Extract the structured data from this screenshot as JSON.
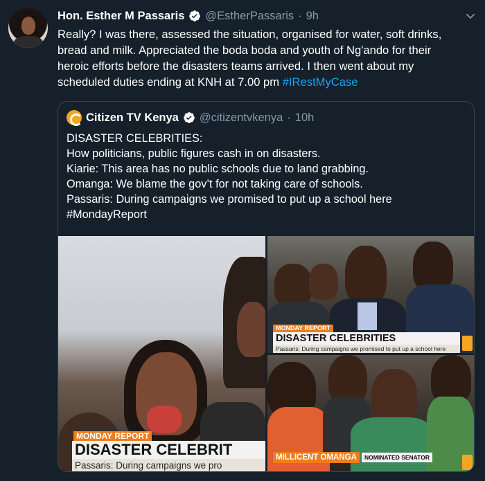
{
  "tweet": {
    "author_name": "Hon. Esther M Passaris",
    "handle": "@EstherPassaris",
    "separator": "·",
    "time": "9h",
    "text_lines": [
      "Really? I was there, assessed the situation, organised for water, soft drinks,",
      "bread and milk. Appreciated the boda boda and youth of Ng'ando for their",
      "heroic efforts before the disasters teams arrived. I then went about my",
      "scheduled duties ending at KNH at 7.00 pm "
    ],
    "hashtag": "#IRestMyCase"
  },
  "quote": {
    "author_name": "Citizen TV Kenya",
    "handle": "@citizentvkenya",
    "separator": "·",
    "time": "10h",
    "lines": [
      "DISASTER CELEBRITIES:",
      "How politicians, public figures cash in on disasters.",
      "Kiarie: This area has no public schools due to land grabbing.",
      "Omanga: We blame the gov’t for not taking care of schools.",
      "Passaris: During campaigns we promised to put up a school here",
      "#MondayReport"
    ],
    "media": {
      "left": {
        "tag": "MONDAY REPORT",
        "headline": "DISASTER CELEBRIT",
        "sub": "Passaris: During campaigns we pro"
      },
      "top_right": {
        "tag": "MONDAY REPORT",
        "headline": "DISASTER CELEBRITIES",
        "sub": "Passaris: During campaigns we promised to put up a school here"
      },
      "bottom_right": {
        "name": "MILLICENT OMANGA",
        "role": "NOMINATED SENATOR"
      }
    }
  },
  "colors": {
    "background": "#15202b",
    "secondary_text": "#8899a6",
    "link": "#1da1f2",
    "border": "#38444d",
    "broadcast_orange": "#ef7d1a"
  },
  "icons": [
    "verified-badge-icon",
    "chevron-down-icon",
    "citizen-tv-logo-icon"
  ]
}
